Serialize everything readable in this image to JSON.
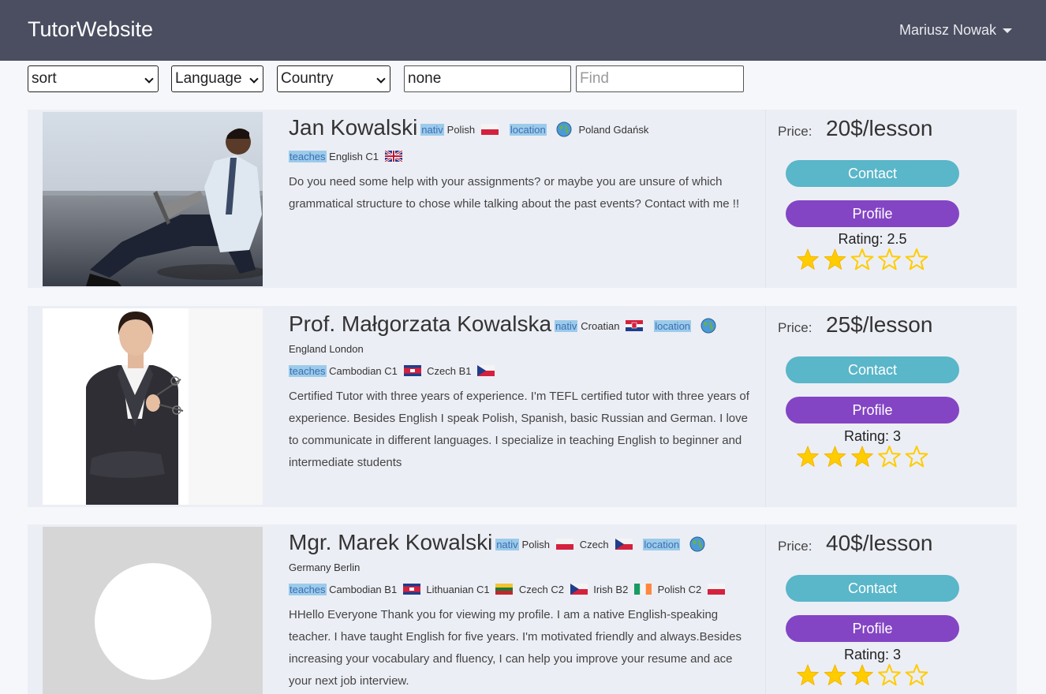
{
  "navbar": {
    "brand": "TutorWebsite",
    "user": "Mariusz Nowak"
  },
  "filters": {
    "sort": "sort",
    "language": "Language",
    "country": "Country",
    "value_input": "none",
    "find_placeholder": "Find"
  },
  "labels": {
    "nativ": "nativ",
    "location": "location",
    "teaches": "teaches",
    "price": "Price:",
    "contact": "Contact",
    "profile": "Profile"
  },
  "tutors": [
    {
      "name": "Jan Kowalski",
      "native": [
        {
          "lang": "Polish",
          "flag": "PL"
        }
      ],
      "location": "Poland Gdańsk",
      "teaches": [
        {
          "lang": "English C1",
          "flag": "GB"
        }
      ],
      "description": "Do you need some help with your assignments? or maybe you are unsure of which grammatical structure to chose while talking about the past events? Contact with me !!",
      "price": "20$/lesson",
      "rating_text": "Rating: 2.5",
      "rating": 2
    },
    {
      "name": "Prof. Małgorzata Kowalska",
      "native": [
        {
          "lang": "Croatian",
          "flag": "HR"
        }
      ],
      "location": "England London",
      "teaches": [
        {
          "lang": "Cambodian C1",
          "flag": "KH"
        },
        {
          "lang": "Czech B1",
          "flag": "CZ"
        }
      ],
      "description": "Certified Tutor with three years of experience. I'm TEFL certified tutor with three years of experience. Besides English I speak Polish, Spanish, basic Russian and German. I love to communicate in different languages. I specialize in teaching English to beginner and intermediate students",
      "price": "25$/lesson",
      "rating_text": "Rating: 3",
      "rating": 3
    },
    {
      "name": "Mgr. Marek Kowalski",
      "native": [
        {
          "lang": "Polish",
          "flag": "PL"
        },
        {
          "lang": "Czech",
          "flag": "CZ"
        }
      ],
      "location": "Germany Berlin",
      "teaches": [
        {
          "lang": "Cambodian B1",
          "flag": "KH"
        },
        {
          "lang": "Lithuanian C1",
          "flag": "LT"
        },
        {
          "lang": "Czech C2",
          "flag": "CZ"
        },
        {
          "lang": "Irish B2",
          "flag": "IE"
        },
        {
          "lang": "Polish C2",
          "flag": "PL"
        }
      ],
      "description": "HHello Everyone Thank you for viewing my profile. I am a native English-speaking teacher. I have taught English for five years. I'm motivated friendly and always.Besides increasing your vocabulary and fluency, I can help you improve your resume and ace your next job interview.",
      "price": "40$/lesson",
      "rating_text": "Rating: 3",
      "rating": 3
    }
  ]
}
